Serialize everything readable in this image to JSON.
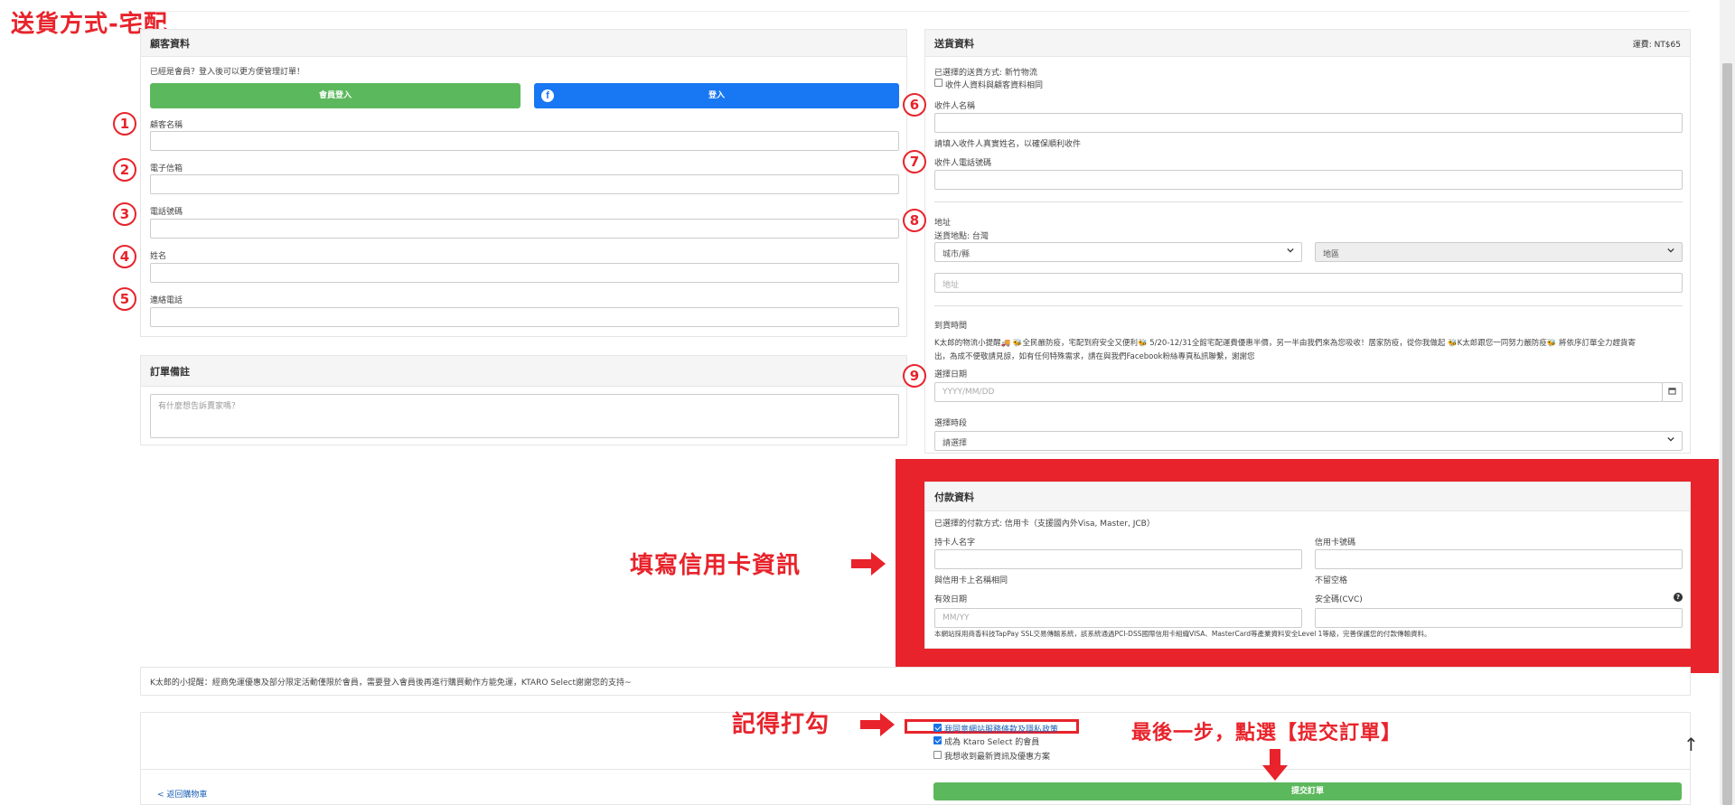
{
  "annotations": {
    "shipping_method": "送貨方式-宅配",
    "fill_card": "填寫信用卡資訊",
    "remember_check": "記得打勾",
    "last_step": "最後一步，點選【提交訂單】",
    "numbers": [
      "1",
      "2",
      "3",
      "4",
      "5",
      "6",
      "7",
      "8",
      "9"
    ]
  },
  "customer": {
    "title": "顧客資料",
    "member_prompt": "已經是會員？登入後可以更方便管理訂單！",
    "member_login": "會員登入",
    "fb_login": "登入",
    "fields": [
      "顧客名稱",
      "電子信箱",
      "電話號碼",
      "姓名",
      "連絡電話"
    ]
  },
  "order_note": {
    "title": "訂單備註",
    "placeholder": "有什麼想告訴賣家嗎？"
  },
  "shipping": {
    "title": "送貨資料",
    "fee": "運費: NT$65",
    "method": "已選擇的送貨方式: 新竹物流",
    "same_as_customer": "收件人資料與顧客資料相同",
    "recipient_name": "收件人名稱",
    "recipient_hint": "請填入收件人真實姓名，以確保順利收件",
    "recipient_phone": "收件人電話號碼",
    "address": "地址",
    "region": "送貨地點: 台灣",
    "city": "城市/縣",
    "district": "地區",
    "address_placeholder": "地址",
    "arrival_time": "到貨時間",
    "notice_line1": "K太郎的物流小提醒🚚 🐝全民嚴防疫，宅配到府安全又便利🐝 5/20-12/31全館宅配運費優惠半價，另一半由我們來為您吸收！居家防疫，從你我做起 🐝K太郎跟您一同努力嚴防疫🐝 將依序訂單全力趕貨寄",
    "notice_line2": "出，為成不便敬請見諒，如有任何特殊需求，請在與我們Facebook粉絲專頁私訊聯繫，謝謝您",
    "select_date": "選擇日期",
    "date_placeholder": "YYYY/MM/DD",
    "select_slot": "選擇時段",
    "slot_value": "請選擇"
  },
  "payment": {
    "title": "付款資料",
    "method": "已選擇的付款方式: 信用卡（支援國內外Visa, Master, JCB）",
    "holder": "持卡人名字",
    "card_no": "信用卡號碼",
    "holder_hint": "與信用卡上名稱相同",
    "no_space": "不留空格",
    "expiry": "有效日期",
    "expiry_placeholder": "MM/YY",
    "cvc": "安全碼(CVC)",
    "security_note": "本網站採用商香科技TapPay SSL交易傳輸系統，該系統通過PCI-DSS國際信用卡組織VISA、MasterCard等產業資料安全Level 1等級，完善保護您的付款傳輸資料。"
  },
  "reminder": "K太郎的小提醒：經商免運優惠及部分限定活動僅限於會員，需要登入會員後再進行購買動作方能免運，KTARO Select謝謝您的支持~",
  "agreements": {
    "terms": "我同意網站服務條款及隱私政策",
    "become_member": "成為 Ktaro Select 的會員",
    "newsletter": "我想收到最新資訊及優惠方案"
  },
  "back_link": "< 返回購物車",
  "submit": "提交訂單",
  "colors": {
    "red": "#e8232b",
    "green": "#5cb85c",
    "fb": "#1877f2"
  }
}
